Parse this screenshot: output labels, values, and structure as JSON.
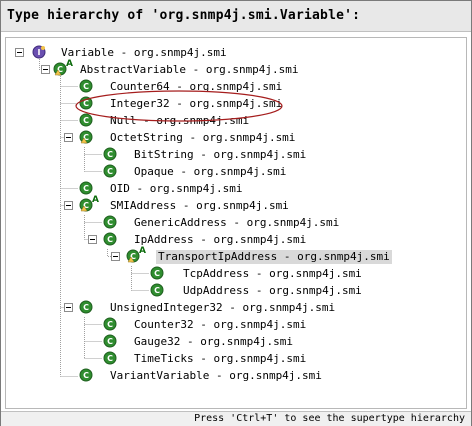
{
  "header": {
    "title": "Type hierarchy of 'org.snmp4j.smi.Variable':"
  },
  "status": {
    "hint": "Press 'Ctrl+T' to see the supertype hierarchy"
  },
  "colors": {
    "class_green": "#2f8d2f",
    "interface_purple": "#6a4fb0",
    "annotation_red": "#a51d1d",
    "selection_bg": "#d9d9d9"
  },
  "tree": {
    "rows": [
      {
        "label": "Variable - org.snmp4j.smi",
        "icon": "interface-icon"
      },
      {
        "label": "AbstractVariable - org.snmp4j.smi",
        "icon": "abstract-class-icon"
      },
      {
        "label": "Counter64 - org.snmp4j.smi",
        "icon": "class-icon"
      },
      {
        "label": "Integer32 - org.snmp4j.smi",
        "icon": "class-icon"
      },
      {
        "label": "Null - org.snmp4j.smi",
        "icon": "class-icon"
      },
      {
        "label": "OctetString - org.snmp4j.smi",
        "icon": "class-icon"
      },
      {
        "label": "BitString - org.snmp4j.smi",
        "icon": "class-icon"
      },
      {
        "label": "Opaque - org.snmp4j.smi",
        "icon": "class-icon"
      },
      {
        "label": "OID - org.snmp4j.smi",
        "icon": "class-icon"
      },
      {
        "label": "SMIAddress - org.snmp4j.smi",
        "icon": "abstract-class-icon"
      },
      {
        "label": "GenericAddress - org.snmp4j.smi",
        "icon": "class-icon"
      },
      {
        "label": "IpAddress - org.snmp4j.smi",
        "icon": "class-icon"
      },
      {
        "label": "TransportIpAddress - org.snmp4j.smi",
        "icon": "abstract-class-icon",
        "selected": true
      },
      {
        "label": "TcpAddress - org.snmp4j.smi",
        "icon": "class-icon"
      },
      {
        "label": "UdpAddress - org.snmp4j.smi",
        "icon": "class-icon"
      },
      {
        "label": "UnsignedInteger32 - org.snmp4j.smi",
        "icon": "class-icon"
      },
      {
        "label": "Counter32 - org.snmp4j.smi",
        "icon": "class-icon"
      },
      {
        "label": "Gauge32 - org.snmp4j.smi",
        "icon": "class-icon"
      },
      {
        "label": "TimeTicks - org.snmp4j.smi",
        "icon": "class-icon"
      },
      {
        "label": "VariantVariable - org.snmp4j.smi",
        "icon": "class-icon"
      }
    ]
  }
}
